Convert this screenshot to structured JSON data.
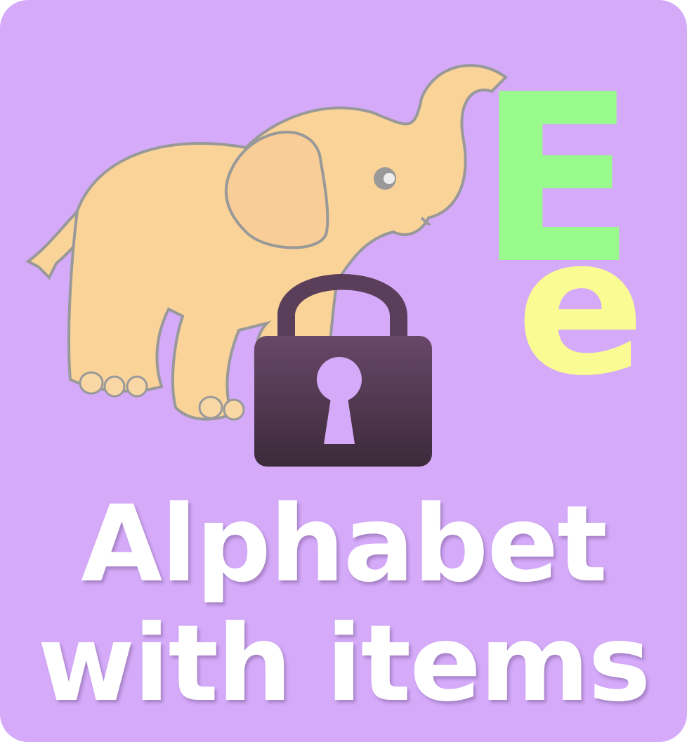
{
  "tile": {
    "title_line1": "Alphabet",
    "title_line2": "with items",
    "letter_upper": "E",
    "letter_lower": "e",
    "item": "elephant",
    "locked": true,
    "icons": [
      "elephant-icon",
      "lock-icon"
    ]
  },
  "colors": {
    "background": "#d4aaf9",
    "elephant": "#fad399",
    "outline": "#999999",
    "upper_letter": "#99fb8c",
    "lower_letter": "#fafb92",
    "lock_top": "#684868",
    "lock_bottom": "#3c2a3a"
  }
}
